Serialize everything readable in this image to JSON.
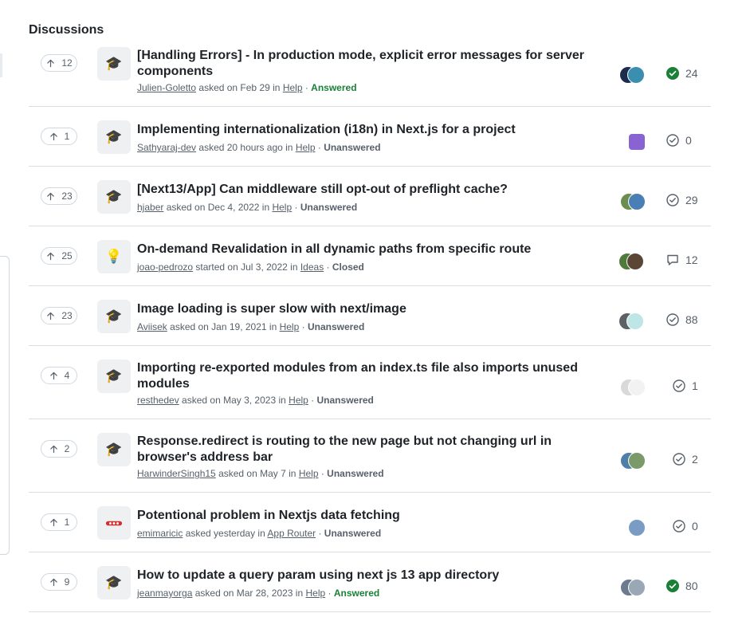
{
  "section_title": "Discussions",
  "discussions": [
    {
      "votes": "12",
      "title": "[Handling Errors] - In production mode, explicit error messages for server components",
      "author": "Julien-Goletto",
      "verb": "asked on Feb 29 in",
      "category": "Help",
      "status": "Answered",
      "count": "24",
      "category_icon": "graduation-cap-icon",
      "stat_icon": "answered-check-icon"
    },
    {
      "votes": "1",
      "title": "Implementing internationalization (i18n) in Next.js for a project",
      "author": "Sathyaraj-dev",
      "verb": "asked 20 hours ago in",
      "category": "Help",
      "status": "Unanswered",
      "count": "0",
      "category_icon": "graduation-cap-icon",
      "stat_icon": "unanswered-check-icon"
    },
    {
      "votes": "23",
      "title": "[Next13/App] Can middleware still opt-out of preflight cache?",
      "author": "hjaber",
      "verb": "asked on Dec 4, 2022 in",
      "category": "Help",
      "status": "Unanswered",
      "count": "29",
      "category_icon": "graduation-cap-icon",
      "stat_icon": "unanswered-check-icon"
    },
    {
      "votes": "25",
      "title": "On-demand Revalidation in all dynamic paths from specific route",
      "author": "joao-pedrozo",
      "verb": "started on Jul 3, 2022 in",
      "category": "Ideas",
      "status": "Closed",
      "count": "12",
      "category_icon": "lightbulb-icon",
      "stat_icon": "comment-icon"
    },
    {
      "votes": "23",
      "title": "Image loading is super slow with next/image",
      "author": "Aviisek",
      "verb": "asked on Jan 19, 2021 in",
      "category": "Help",
      "status": "Unanswered",
      "count": "88",
      "category_icon": "graduation-cap-icon",
      "stat_icon": "unanswered-check-icon"
    },
    {
      "votes": "4",
      "title": "Importing re-exported modules from an index.ts file also imports unused modules",
      "author": "resthedev",
      "verb": "asked on May 3, 2023 in",
      "category": "Help",
      "status": "Unanswered",
      "count": "1",
      "category_icon": "graduation-cap-icon",
      "stat_icon": "unanswered-check-icon"
    },
    {
      "votes": "2",
      "title": "Response.redirect is routing to the new page but not changing url in browser's address bar",
      "author": "HarwinderSingh15",
      "verb": "asked on May 7 in",
      "category": "Help",
      "status": "Unanswered",
      "count": "2",
      "category_icon": "graduation-cap-icon",
      "stat_icon": "unanswered-check-icon"
    },
    {
      "votes": "1",
      "title": "Potentional problem in Nextjs data fetching",
      "author": "emimaricic",
      "verb": "asked yesterday in",
      "category": "App Router",
      "status": "Unanswered",
      "count": "0",
      "category_icon": "app-router-icon",
      "stat_icon": "unanswered-check-icon"
    },
    {
      "votes": "9",
      "title": "How to update a query param using next js 13 app directory",
      "author": "jeanmayorga",
      "verb": "asked on Mar 28, 2023 in",
      "category": "Help",
      "status": "Answered",
      "count": "80",
      "category_icon": "graduation-cap-icon",
      "stat_icon": "answered-check-icon"
    }
  ],
  "colors": {
    "answered": "#1a7f37",
    "muted": "#57606a",
    "border": "#d8dee4"
  }
}
